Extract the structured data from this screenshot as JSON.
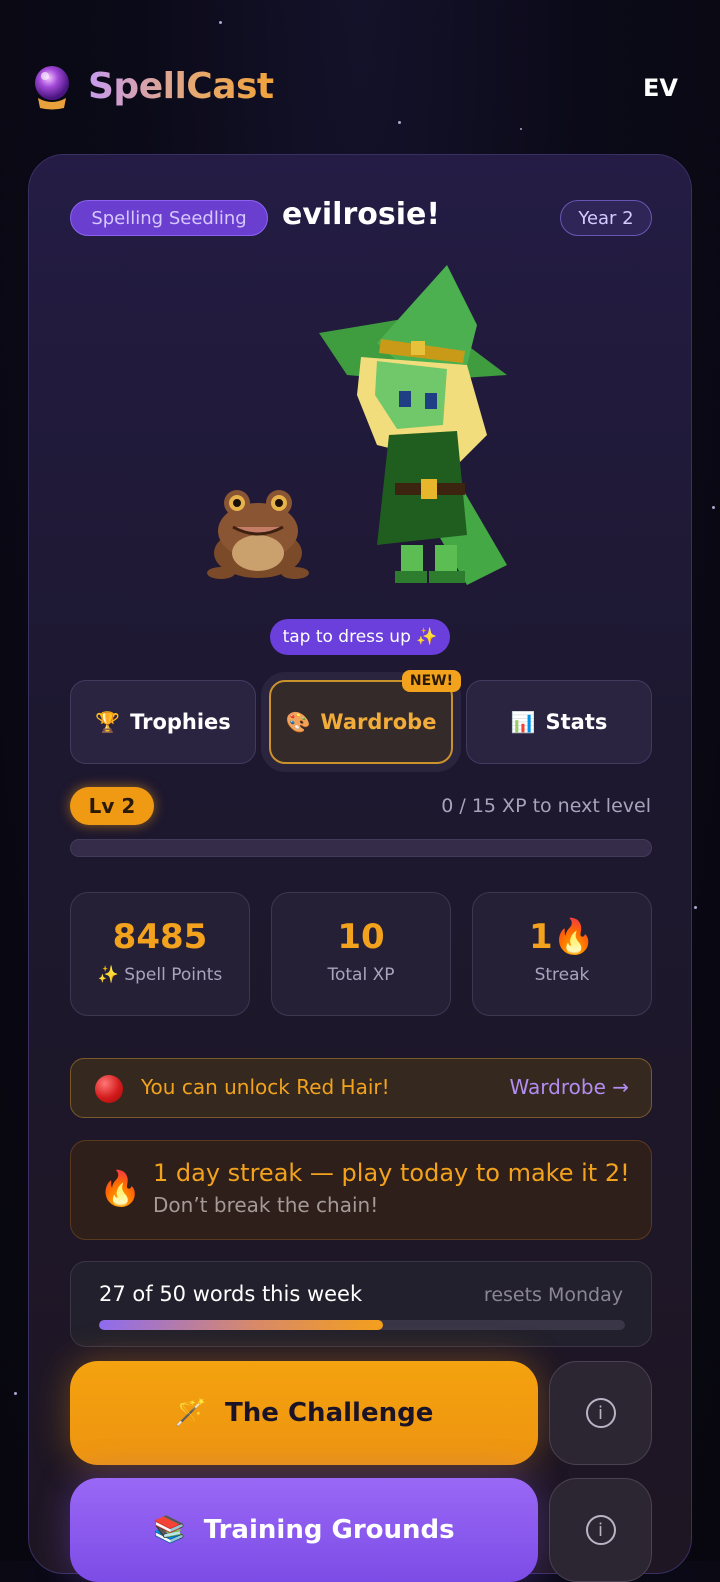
{
  "header": {
    "app_name": "SpellCast",
    "user_initials": "EV"
  },
  "profile": {
    "rank": "Spelling Seedling",
    "username": "evilrosie!",
    "year": "Year 2",
    "dress_up_label": "tap to dress up ✨"
  },
  "tabs": [
    {
      "icon": "🏆",
      "label": "Trophies",
      "active": false
    },
    {
      "icon": "🎨",
      "label": "Wardrobe",
      "active": true,
      "badge": "NEW!"
    },
    {
      "icon": "📊",
      "label": "Stats",
      "active": false
    }
  ],
  "level": {
    "label": "Lv 2",
    "xp_text": "0 / 15 XP to next level",
    "progress_fraction": 0
  },
  "stats": [
    {
      "value": "8485",
      "label": "✨ Spell Points"
    },
    {
      "value": "10",
      "label": "Total XP"
    },
    {
      "value": "1🔥",
      "label": "Streak"
    }
  ],
  "unlock_banner": {
    "text": "You can unlock Red Hair!",
    "link": "Wardrobe →"
  },
  "streak_banner": {
    "title": "1 day streak — play today to make it 2!",
    "subtitle": "Don’t break the chain!"
  },
  "weekly": {
    "text": "27 of 50 words this week",
    "reset": "resets Monday",
    "done": 27,
    "goal": 50
  },
  "actions": [
    {
      "icon": "🪄",
      "label": "The Challenge",
      "info": "i"
    },
    {
      "icon": "📚",
      "label": "Training Grounds",
      "info": "i"
    }
  ],
  "colors": {
    "accent_orange": "#f2a21c",
    "accent_purple": "#7c4ce6",
    "background": "#0b0a18"
  }
}
